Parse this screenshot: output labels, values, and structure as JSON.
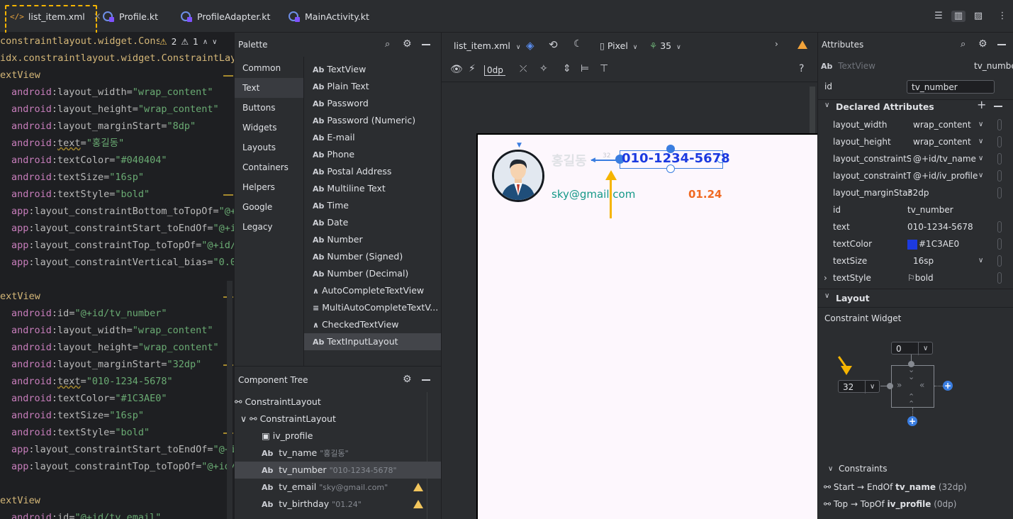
{
  "tabs": [
    {
      "label": "list_item.xml",
      "active": true
    },
    {
      "label": "Profile.kt"
    },
    {
      "label": "ProfileAdapter.kt"
    },
    {
      "label": "MainActivity.kt"
    }
  ],
  "editor": {
    "warnings": {
      "warn_count": "2",
      "weak_count": "1"
    },
    "lines": [
      {
        "text": "constraintlayout.widget.Cons",
        "type": "tag"
      },
      {
        "text": "idx.constraintlayout.widget.ConstraintLay",
        "type": "tag"
      },
      {
        "text": "extView",
        "type": "tag"
      },
      {
        "ns": "android",
        "attr": "layout_width",
        "val": "\"wrap_content\""
      },
      {
        "ns": "android",
        "attr": "layout_height",
        "val": "\"wrap_content\""
      },
      {
        "ns": "android",
        "attr": "layout_marginStart",
        "val": "\"8dp\""
      },
      {
        "ns": "android",
        "attr": "text",
        "val": "\"홍길동\"",
        "squiggle": true
      },
      {
        "ns": "android",
        "attr": "textColor",
        "val": "\"#040404\""
      },
      {
        "ns": "android",
        "attr": "textSize",
        "val": "\"16sp\""
      },
      {
        "ns": "android",
        "attr": "textStyle",
        "val": "\"bold\""
      },
      {
        "ns": "app",
        "attr": "layout_constraintBottom_toTopOf",
        "val": "\"@+"
      },
      {
        "ns": "app",
        "attr": "layout_constraintStart_toEndOf",
        "val": "\"@+i"
      },
      {
        "ns": "app",
        "attr": "layout_constraintTop_toTopOf",
        "val": "\"@+id/"
      },
      {
        "ns": "app",
        "attr": "layout_constraintVertical_bias",
        "val": "\"0.0"
      },
      {
        "text": "",
        "type": "blank"
      },
      {
        "text": "extView",
        "type": "tag"
      },
      {
        "ns": "android",
        "attr": "id",
        "val": "\"@+id/tv_number\""
      },
      {
        "ns": "android",
        "attr": "layout_width",
        "val": "\"wrap_content\""
      },
      {
        "ns": "android",
        "attr": "layout_height",
        "val": "\"wrap_content\""
      },
      {
        "ns": "android",
        "attr": "layout_marginStart",
        "val": "\"32dp\""
      },
      {
        "ns": "android",
        "attr": "text",
        "val": "\"010-1234-5678\"",
        "squiggle": true
      },
      {
        "ns": "android",
        "attr": "textColor",
        "val": "\"#1C3AE0\""
      },
      {
        "ns": "android",
        "attr": "textSize",
        "val": "\"16sp\""
      },
      {
        "ns": "android",
        "attr": "textStyle",
        "val": "\"bold\""
      },
      {
        "ns": "app",
        "attr": "layout_constraintStart_toEndOf",
        "val": "\"@+i"
      },
      {
        "ns": "app",
        "attr": "layout_constraintTop_toTopOf",
        "val": "\"@+id/"
      },
      {
        "text": "",
        "type": "blank"
      },
      {
        "text": "extView",
        "type": "tag"
      },
      {
        "ns": "android",
        "attr": "id",
        "val": "\"@+id/tv_email\""
      }
    ]
  },
  "palette": {
    "title": "Palette",
    "categories": [
      "Common",
      "Text",
      "Buttons",
      "Widgets",
      "Layouts",
      "Containers",
      "Helpers",
      "Google",
      "Legacy"
    ],
    "selected_category": "Text",
    "items": [
      "TextView",
      "Plain Text",
      "Password",
      "Password (Numeric)",
      "E-mail",
      "Phone",
      "Postal Address",
      "Multiline Text",
      "Time",
      "Date",
      "Number",
      "Number (Signed)",
      "Number (Decimal)",
      "AutoCompleteTextView",
      "MultiAutoCompleteTextV...",
      "CheckedTextView",
      "TextInputLayout"
    ],
    "selected_item": "TextInputLayout"
  },
  "component_tree": {
    "title": "Component Tree",
    "nodes": [
      {
        "label": "ConstraintLayout",
        "hint": ""
      },
      {
        "label": "ConstraintLayout",
        "hint": ""
      },
      {
        "label": "iv_profile",
        "hint": ""
      },
      {
        "label": "tv_name",
        "hint": "\"홍길동\""
      },
      {
        "label": "tv_number",
        "hint": "\"010-1234-5678\"",
        "selected": true
      },
      {
        "label": "tv_email",
        "hint": "\"sky@gmail.com\"",
        "warning": true
      },
      {
        "label": "tv_birthday",
        "hint": "\"01.24\"",
        "warning": true
      }
    ]
  },
  "design_toolbar": {
    "file": "list_item.xml",
    "device": "Pixel",
    "api": "35",
    "margin": "0dp",
    "help": "?"
  },
  "preview": {
    "name": "홍길동",
    "number": "010-1234-5678",
    "email": "sky@gmail.com",
    "birthday": "01.24",
    "margin_hint": "32",
    "colors": {
      "number": "#1C3AE0",
      "email": "#159988",
      "birthday": "#f06a23",
      "name": "#040404"
    }
  },
  "attributes": {
    "title": "Attributes",
    "widget_type": "TextView",
    "widget_id": "tv_number",
    "id_label": "id",
    "id_value": "tv_number",
    "declared_title": "Declared Attributes",
    "declared": [
      {
        "key": "layout_width",
        "value": "wrap_content",
        "dropdown": true
      },
      {
        "key": "layout_height",
        "value": "wrap_content",
        "dropdown": true
      },
      {
        "key": "layout_constraintS...",
        "value": "@+id/tv_name",
        "dropdown": true
      },
      {
        "key": "layout_constraintT...",
        "value": "@+id/iv_profile",
        "dropdown": true
      },
      {
        "key": "layout_marginStart",
        "value": "32dp"
      },
      {
        "key": "id",
        "value": "tv_number"
      },
      {
        "key": "text",
        "value": "010-1234-5678"
      },
      {
        "key": "textColor",
        "value": "#1C3AE0",
        "swatch": "#1C3AE0"
      },
      {
        "key": "textSize",
        "value": "16sp",
        "dropdown": true
      },
      {
        "key": "textStyle",
        "value": "bold",
        "expand": true
      }
    ],
    "layout_title": "Layout",
    "constraint_widget_label": "Constraint Widget",
    "top_margin": "0",
    "start_margin": "32",
    "constraints_title": "Constraints",
    "constraints": [
      {
        "prefix": "Start → EndOf",
        "target": "tv_name",
        "margin": "(32dp)"
      },
      {
        "prefix": "Top → TopOf",
        "target": "iv_profile",
        "margin": "(0dp)"
      }
    ]
  }
}
